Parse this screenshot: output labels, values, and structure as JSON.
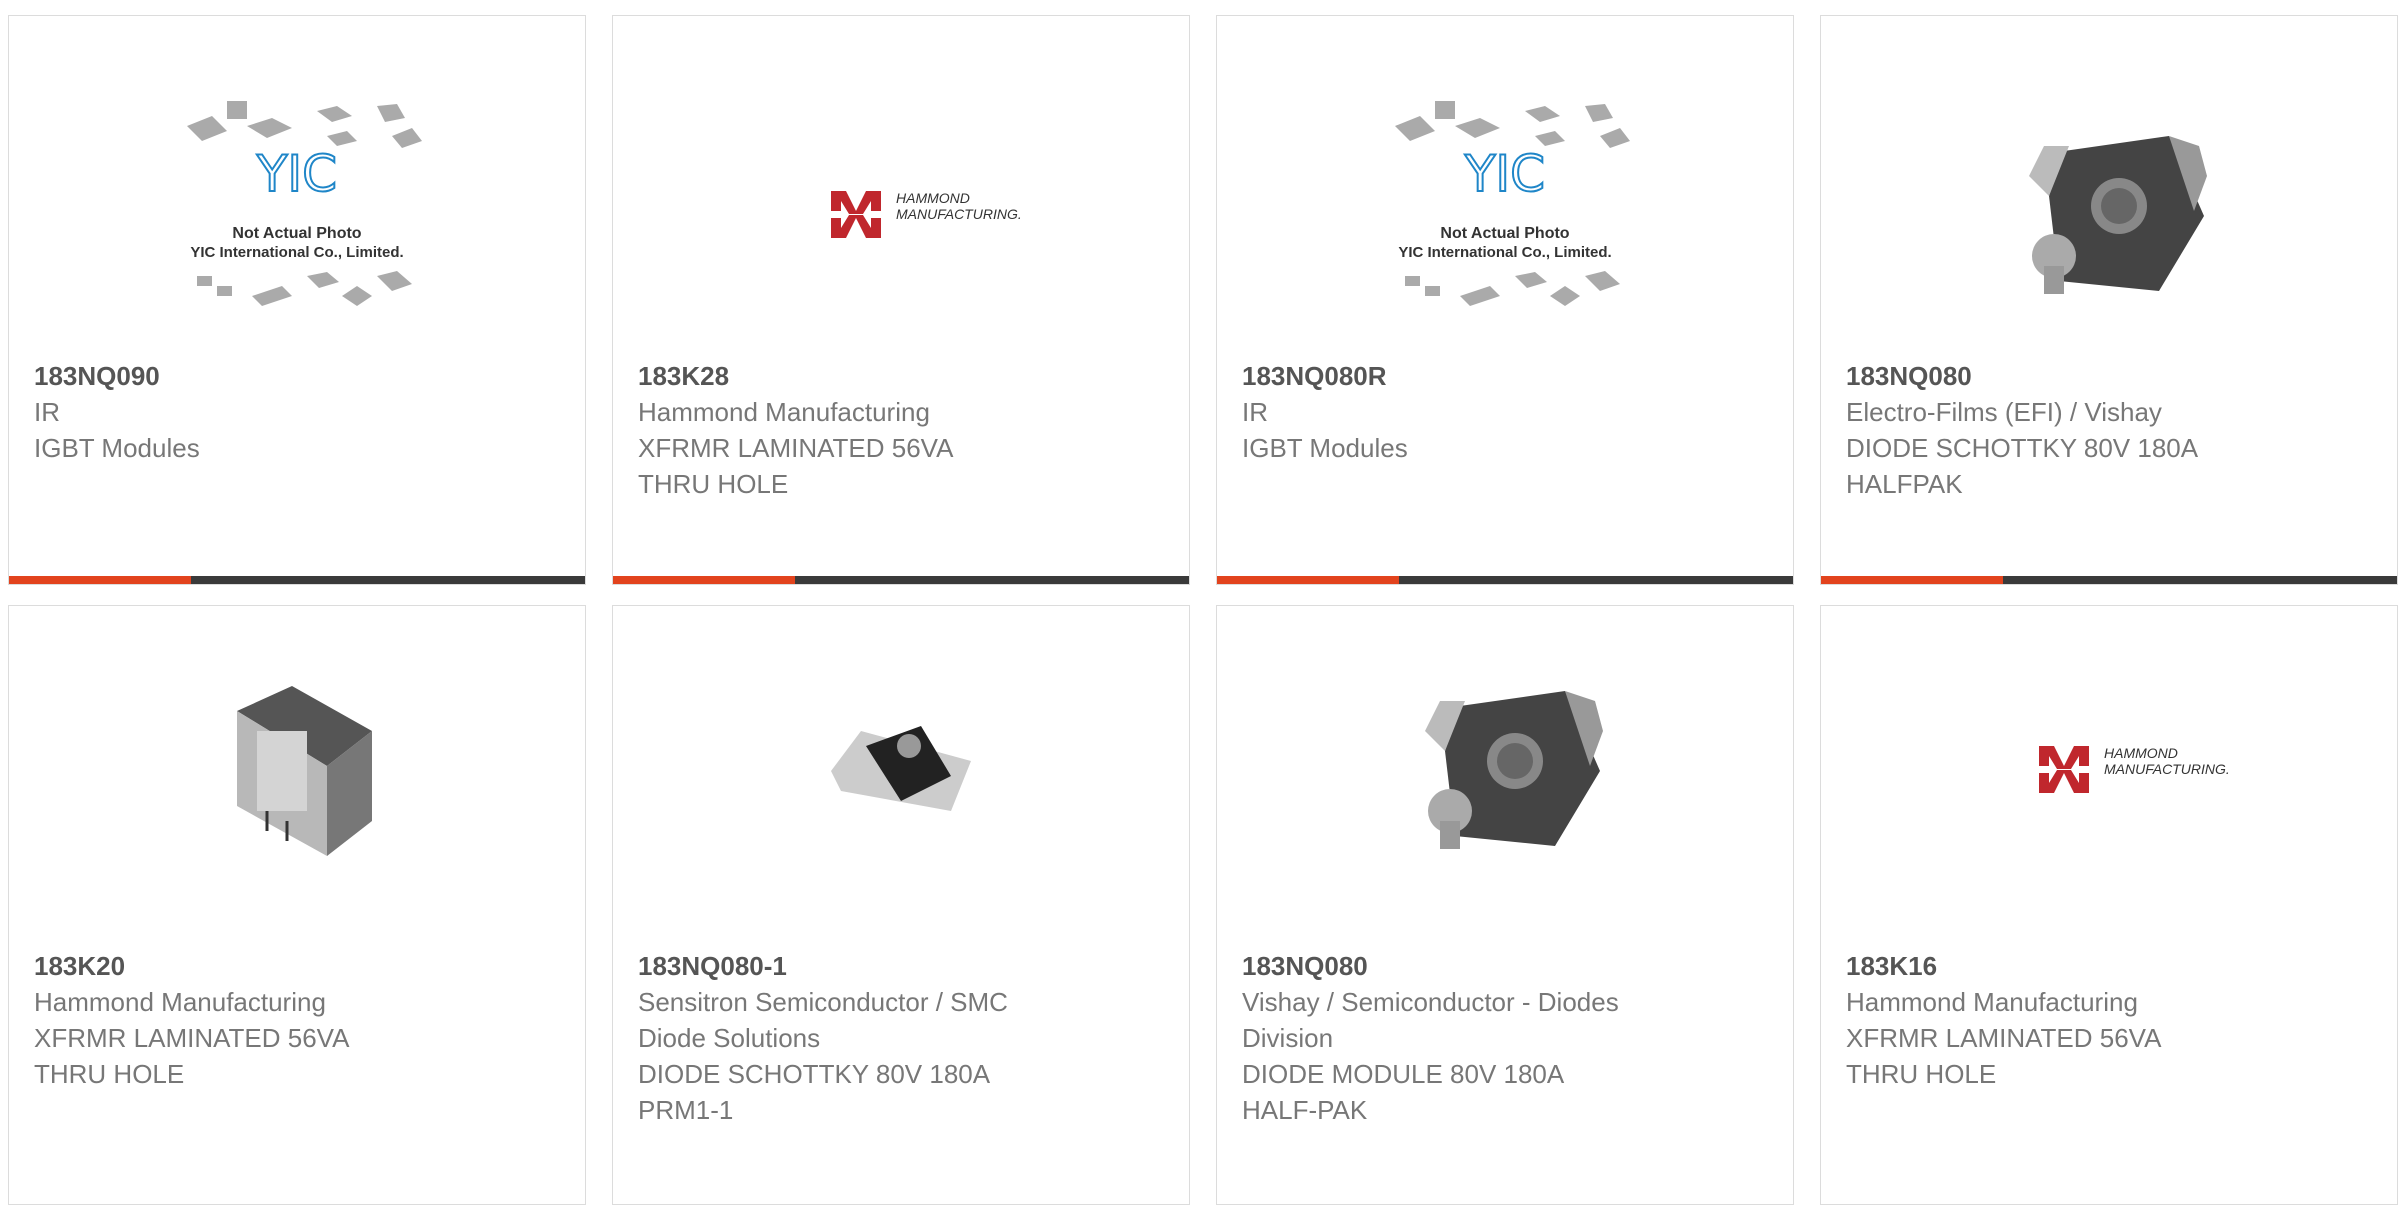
{
  "products": [
    {
      "part": "183NQ090",
      "lines": [
        "IR",
        "IGBT Modules"
      ],
      "image": "yic-placeholder",
      "photo_text": [
        "Not Actual Photo",
        "YIC International Co., Limited."
      ],
      "brand_text": "YIC"
    },
    {
      "part": "183K28",
      "lines": [
        "Hammond Manufacturing",
        "XFRMR LAMINATED 56VA",
        "THRU HOLE"
      ],
      "image": "hammond-logo",
      "logo_text": [
        "HAMMOND",
        "MANUFACTURING."
      ]
    },
    {
      "part": "183NQ080R",
      "lines": [
        "IR",
        "IGBT Modules"
      ],
      "image": "yic-placeholder",
      "photo_text": [
        "Not Actual Photo",
        "YIC International Co., Limited."
      ],
      "brand_text": "YIC"
    },
    {
      "part": "183NQ080",
      "lines": [
        "Electro-Films (EFI) / Vishay",
        "DIODE SCHOTTKY 80V 180A",
        "HALFPAK"
      ],
      "image": "halfpak-diode"
    },
    {
      "part": "183K20",
      "lines": [
        "Hammond Manufacturing",
        "XFRMR LAMINATED 56VA",
        "THRU HOLE"
      ],
      "image": "transformer"
    },
    {
      "part": "183NQ080-1",
      "lines": [
        "Sensitron Semiconductor / SMC",
        "Diode Solutions",
        "DIODE SCHOTTKY 80V 180A",
        "PRM1-1"
      ],
      "image": "prm-diode"
    },
    {
      "part": "183NQ080",
      "lines": [
        "Vishay / Semiconductor - Diodes",
        "Division",
        "DIODE MODULE 80V 180A",
        "HALF-PAK"
      ],
      "image": "halfpak-diode"
    },
    {
      "part": "183K16",
      "lines": [
        "Hammond Manufacturing",
        "XFRMR LAMINATED 56VA",
        "THRU HOLE"
      ],
      "image": "hammond-logo",
      "logo_text": [
        "HAMMOND",
        "MANUFACTURING."
      ]
    }
  ],
  "colors": {
    "accent": "#e2431d",
    "bar": "#3a3a3a",
    "hammond_red": "#c0272d",
    "yic_blue": "#1f86c8"
  }
}
